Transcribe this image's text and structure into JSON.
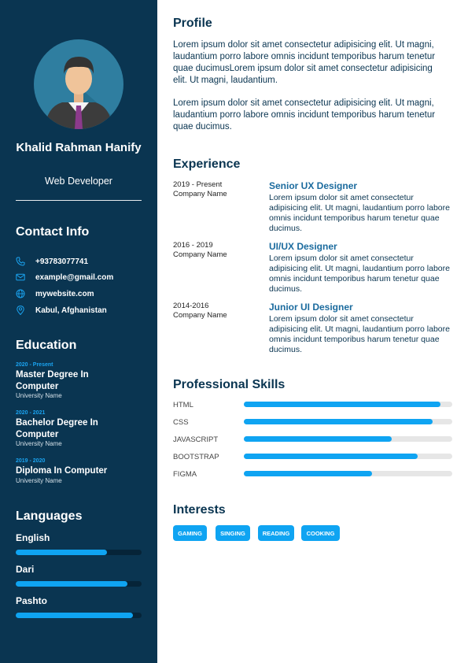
{
  "person": {
    "name": "Khalid Rahman Hanify",
    "role": "Web Developer"
  },
  "contact": {
    "heading": "Contact Info",
    "items": [
      {
        "icon": "phone-icon",
        "text": "+93783077741"
      },
      {
        "icon": "mail-icon",
        "text": "example@gmail.com"
      },
      {
        "icon": "globe-icon",
        "text": "mywebsite.com"
      },
      {
        "icon": "location-pin-icon",
        "text": "Kabul, Afghanistan"
      }
    ]
  },
  "education": {
    "heading": "Education",
    "items": [
      {
        "years": "2020 - Present",
        "degree": "Master Degree In Computer",
        "school": "University Name"
      },
      {
        "years": "2020 - 2021",
        "degree": "Bachelor Degree In Computer",
        "school": "University Name"
      },
      {
        "years": "2019 - 2020",
        "degree": "Diploma In Computer",
        "school": "University Name"
      }
    ]
  },
  "languages": {
    "heading": "Languages",
    "items": [
      {
        "name": "English",
        "level": 0.725
      },
      {
        "name": "Dari",
        "level": 0.89
      },
      {
        "name": "Pashto",
        "level": 0.93
      }
    ]
  },
  "profile": {
    "heading": "Profile",
    "paragraphs": [
      "Lorem ipsum dolor sit amet consectetur adipisicing elit. Ut magni, laudantium porro labore omnis incidunt temporibus harum tenetur quae ducimusLorem ipsum dolor sit amet consectetur adipisicing elit. Ut magni, laudantium.",
      "Lorem ipsum dolor sit amet consectetur adipisicing elit. Ut magni, laudantium porro labore omnis incidunt temporibus harum tenetur quae ducimus."
    ]
  },
  "experience": {
    "heading": "Experience",
    "items": [
      {
        "period": "2019 - Present",
        "company": "Company Name",
        "title": "Senior UX Designer",
        "description": "Lorem ipsum dolor sit amet consectetur adipisicing elit. Ut magni, laudantium porro labore omnis incidunt temporibus harum tenetur quae ducimus."
      },
      {
        "period": "2016 - 2019",
        "company": "Company Name",
        "title": "UI/UX Designer",
        "description": "Lorem ipsum dolor sit amet consectetur adipisicing elit. Ut magni, laudantium porro labore omnis incidunt temporibus harum tenetur quae ducimus."
      },
      {
        "period": "2014-2016",
        "company": "Company Name",
        "title": "Junior UI Designer",
        "description": "Lorem ipsum dolor sit amet consectetur adipisicing elit. Ut magni, laudantium porro labore omnis incidunt temporibus harum tenetur quae ducimus."
      }
    ]
  },
  "skills": {
    "heading": "Professional Skills",
    "items": [
      {
        "name": "HTML",
        "level": 0.945
      },
      {
        "name": "CSS",
        "level": 0.905
      },
      {
        "name": "JAVASCRIPT",
        "level": 0.71
      },
      {
        "name": "BOOTSTRAP",
        "level": 0.835
      },
      {
        "name": "FIGMA",
        "level": 0.615
      }
    ]
  },
  "interests": {
    "heading": "Interests",
    "items": [
      "GAMING",
      "SINGING",
      "READING",
      "COOKING"
    ]
  },
  "colors": {
    "sidebar": "#0a3551",
    "accent": "#0fa4f2",
    "title_blue": "#1b6b9e"
  }
}
